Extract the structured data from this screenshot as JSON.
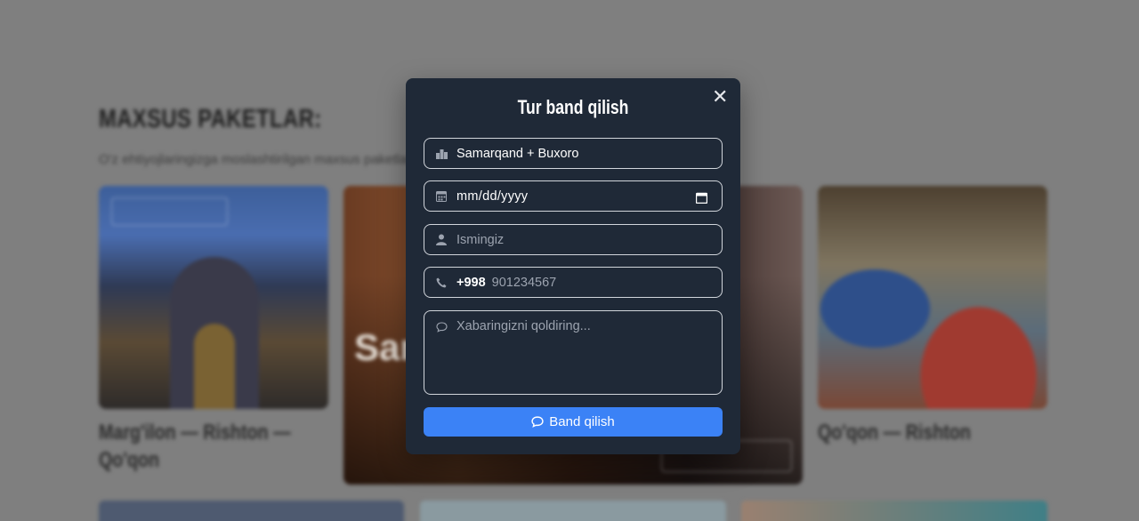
{
  "background": {
    "heading": "MAXSUS PAKETLAR:",
    "subtitle": "O'z ehtiyojlaringizga moslashtirilgan maxsus paketlar bilan sayohatingizni rejalashtiring",
    "cards": [
      {
        "title": "Marg'ilon — Rishton — Qo'qon",
        "tag": "Buyurtma berish"
      },
      {
        "title": "Sam",
        "button": "Buyurtma berish"
      },
      {
        "title": "Qo'qon — Rishton"
      }
    ]
  },
  "modal": {
    "title": "Tur band qilish",
    "close_icon": "close-icon",
    "tour_field": {
      "value": "Samarqand + Buxoro",
      "icon": "city-icon"
    },
    "date_field": {
      "value": "mm/dd/yyyy",
      "icon": "calendar-icon"
    },
    "name_field": {
      "placeholder": "Ismingiz",
      "icon": "user-icon"
    },
    "phone_field": {
      "prefix": "+998",
      "placeholder": "901234567",
      "icon": "phone-icon"
    },
    "message_field": {
      "placeholder": "Xabaringizni qoldiring...",
      "icon": "comment-icon"
    },
    "submit": {
      "label": "Band qilish",
      "icon": "comment-icon"
    }
  },
  "colors": {
    "overlay": "#7f7f7f",
    "modal_bg": "#1f2937",
    "accent": "#3b82f6",
    "border": "#d1d5db"
  }
}
